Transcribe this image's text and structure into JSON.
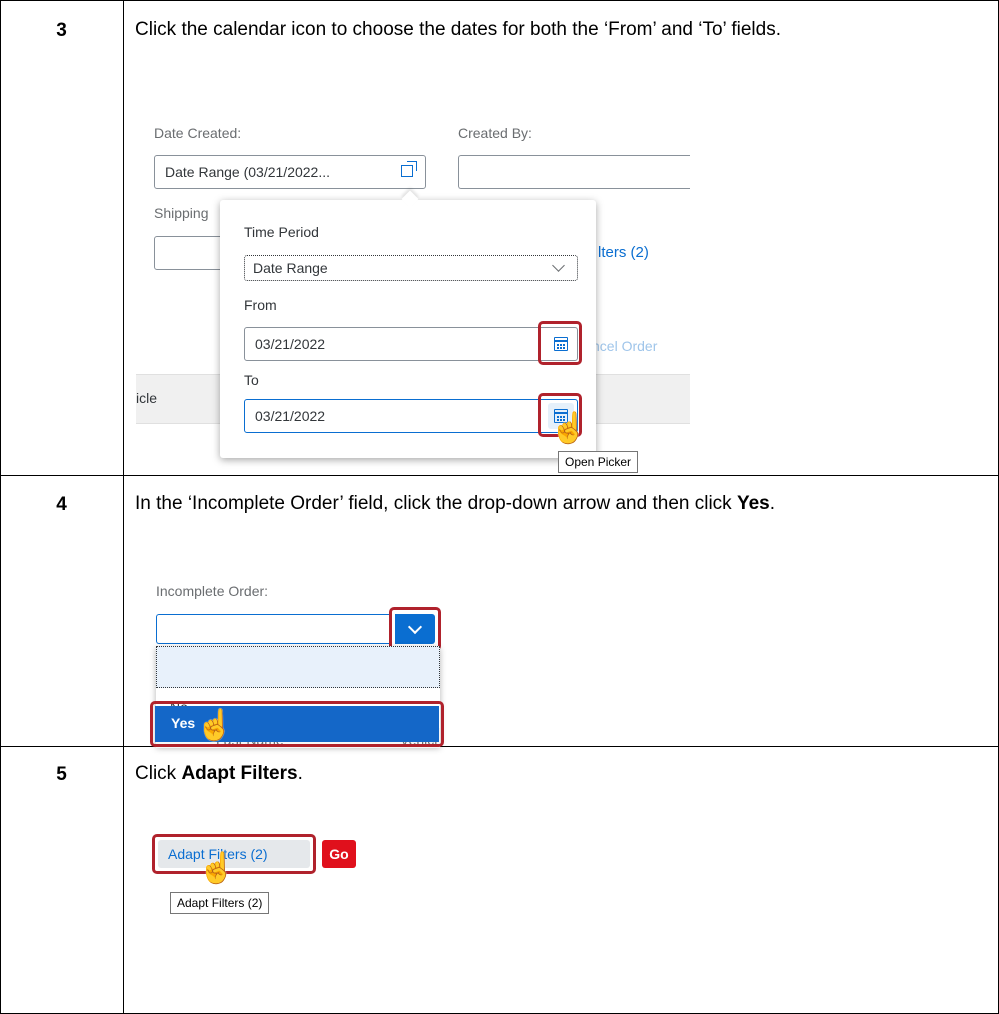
{
  "steps": [
    {
      "number": "3",
      "text": "Click the calendar icon to choose the dates for both the ‘From’ and ‘To’ fields."
    },
    {
      "number": "4",
      "text_pre": "In the ‘Incomplete Order’ field, click the drop-down arrow and then click ",
      "text_bold": "Yes",
      "text_post": "."
    },
    {
      "number": "5",
      "text_pre": "Click ",
      "text_bold": "Adapt Filters",
      "text_post": "."
    }
  ],
  "screen3": {
    "date_created_label": "Date Created:",
    "created_by_label": "Created By:",
    "date_created_value": "Date Range (03/21/2022...",
    "shipping_label": "Shipping",
    "adapt_filters_partial": "lters (2)",
    "cancel_order_partial": "ncel Order",
    "vehicle_partial": "icle",
    "popover": {
      "time_period_label": "Time Period",
      "time_period_value": "Date Range",
      "from_label": "From",
      "from_value": "03/21/2022",
      "to_label": "To",
      "to_value": "03/21/2022"
    },
    "tooltip": "Open Picker"
  },
  "screen4": {
    "label": "Incomplete Order:",
    "options": [
      "",
      "No",
      "Yes"
    ],
    "behind_text": "Last Name",
    "behind_text2": "Vehicl"
  },
  "screen5": {
    "adapt_filters_label": "Adapt Filters (2)",
    "go_label": "Go",
    "tooltip": "Adapt Filters (2)"
  }
}
